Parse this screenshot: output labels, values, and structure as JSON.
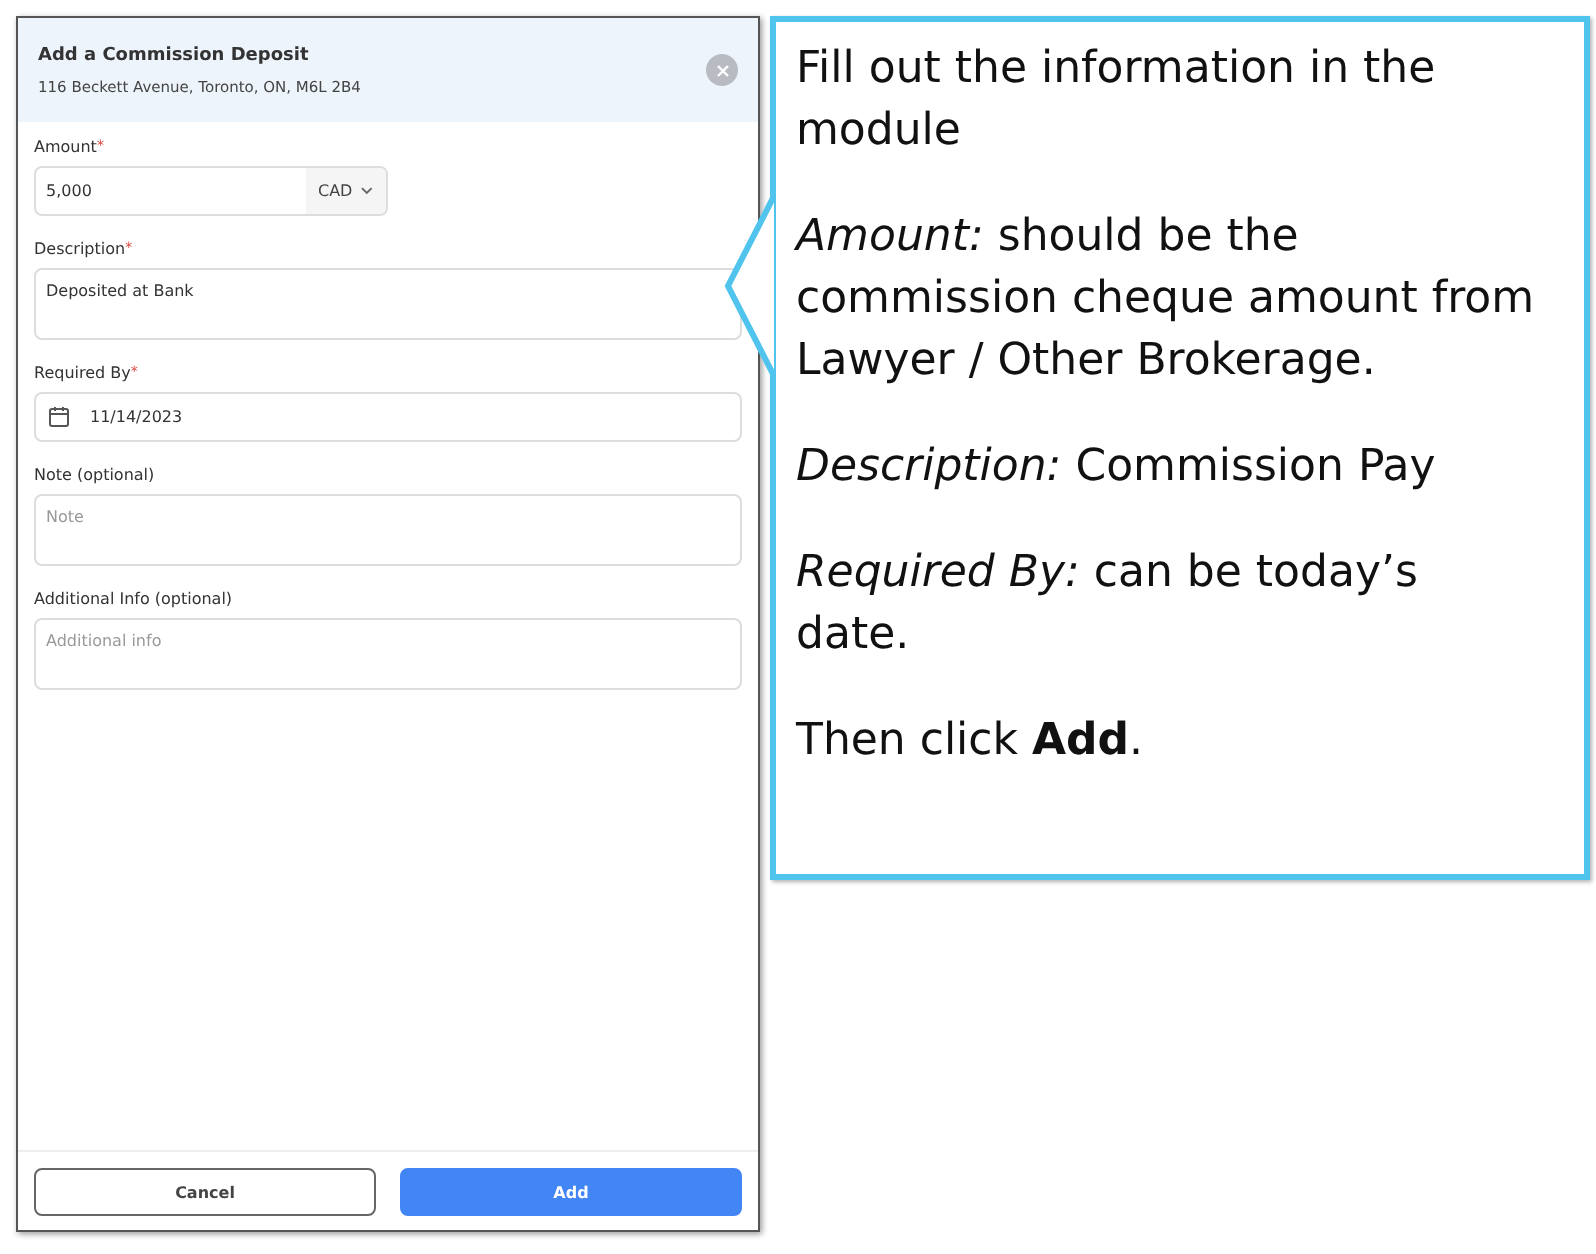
{
  "modal": {
    "title": "Add a Commission Deposit",
    "subtitle": "116 Beckett Avenue, Toronto, ON, M6L 2B4",
    "fields": [
      {
        "kind": "amount",
        "label": "Amount",
        "required_mark": "*",
        "value": "5,000",
        "currency": "CAD"
      },
      {
        "kind": "textarea",
        "label": "Description",
        "required_mark": "*",
        "value": "Deposited at Bank"
      },
      {
        "kind": "date",
        "label": "Required By",
        "required_mark": "*",
        "value": "11/14/2023"
      },
      {
        "kind": "textarea",
        "label": "Note (optional)",
        "placeholder": "Note"
      },
      {
        "kind": "textarea",
        "label": "Additional Info (optional)",
        "placeholder": "Additional info"
      }
    ],
    "buttons": [
      {
        "kind": "secondary",
        "label": "Cancel"
      },
      {
        "kind": "primary",
        "label": "Add"
      }
    ]
  },
  "callout": {
    "paragraphs": [
      "Fill out the information in the module",
      "*Amount:* should be the commission cheque amount from Lawyer / Other Brokerage.",
      "*Description:* Commission Pay",
      "*Required By:* can be today’s date.",
      "Then click **Add**."
    ]
  }
}
